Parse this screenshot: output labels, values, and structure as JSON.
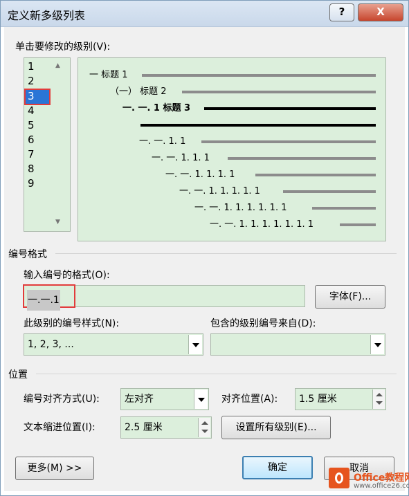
{
  "dialog": {
    "title": "定义新多级列表",
    "help_label": "?",
    "close_label": "X"
  },
  "level_section": {
    "label": "单击要修改的级别(V):",
    "levels": [
      "1",
      "2",
      "3",
      "4",
      "5",
      "6",
      "7",
      "8",
      "9"
    ],
    "selected_level": "3"
  },
  "preview": {
    "rows": [
      {
        "text": "一 标题 1"
      },
      {
        "text": "（一） 标题 2"
      },
      {
        "text": "一. 一. 1 标题 3"
      },
      {
        "text": ""
      },
      {
        "text": "一. 一. 1. 1"
      },
      {
        "text": "一. 一. 1. 1. 1"
      },
      {
        "text": "一. 一. 1. 1. 1. 1"
      },
      {
        "text": "一. 一. 1. 1. 1. 1. 1"
      },
      {
        "text": "一. 一. 1. 1. 1. 1. 1. 1"
      },
      {
        "text": "一. 一. 1. 1. 1. 1. 1. 1. 1"
      }
    ]
  },
  "number_format": {
    "group_label": "编号格式",
    "format_label": "输入编号的格式(O):",
    "format_value": "一.一.1",
    "font_button": "字体(F)...",
    "style_label": "此级别的编号样式(N):",
    "style_value": "1, 2, 3, ...",
    "include_label": "包含的级别编号来自(D):",
    "include_value": ""
  },
  "position": {
    "group_label": "位置",
    "align_label": "编号对齐方式(U):",
    "align_value": "左对齐",
    "align_at_label": "对齐位置(A):",
    "align_at_value": "1.5 厘米",
    "indent_label": "文本缩进位置(I):",
    "indent_value": "2.5 厘米",
    "set_all_button": "设置所有级别(E)..."
  },
  "footer": {
    "more_button": "更多(M) >>",
    "ok_button": "确定",
    "cancel_button": "取消"
  },
  "watermark": {
    "brand": "Office教程网",
    "url": "www.office26.com"
  }
}
